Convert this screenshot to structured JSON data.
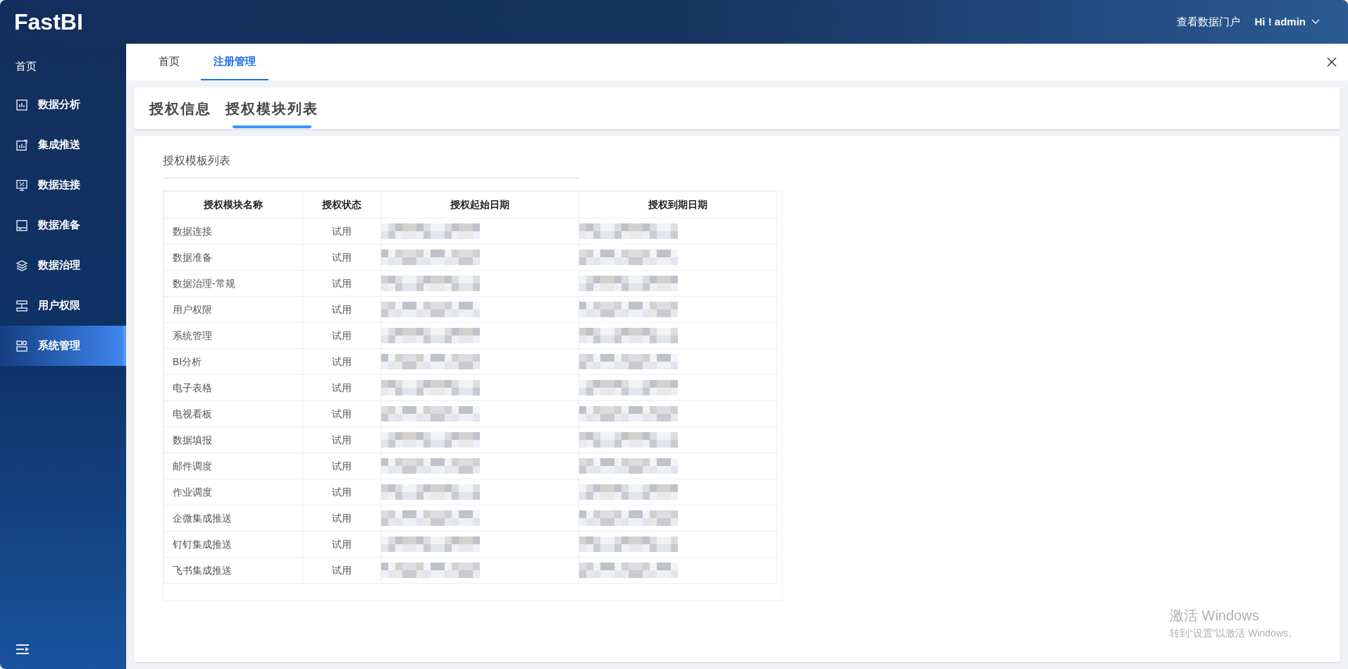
{
  "header": {
    "logo": "FastBI",
    "portal_link": "查看数据门户",
    "user_menu": "Hi ! admin"
  },
  "sidebar": {
    "home": "首页",
    "items": [
      {
        "label": "数据分析",
        "selected": false
      },
      {
        "label": "集成推送",
        "selected": false
      },
      {
        "label": "数据连接",
        "selected": false
      },
      {
        "label": "数据准备",
        "selected": false
      },
      {
        "label": "数据治理",
        "selected": false
      },
      {
        "label": "用户权限",
        "selected": false
      },
      {
        "label": "系统管理",
        "selected": true
      }
    ]
  },
  "tabs": [
    {
      "label": "首页",
      "selected": false
    },
    {
      "label": "注册管理",
      "selected": true
    }
  ],
  "sub_tabs": [
    {
      "label": "授权信息",
      "selected": false
    },
    {
      "label": "授权模块列表",
      "selected": true
    }
  ],
  "section_title": "授权模板列表",
  "table": {
    "columns": [
      "授权模块名称",
      "授权状态",
      "授权起始日期",
      "授权到期日期"
    ],
    "rows": [
      {
        "name": "数据连接",
        "status": "试用"
      },
      {
        "name": "数据准备",
        "status": "试用"
      },
      {
        "name": "数据治理-常规",
        "status": "试用"
      },
      {
        "name": "用户权限",
        "status": "试用"
      },
      {
        "name": "系统管理",
        "status": "试用"
      },
      {
        "name": "BI分析",
        "status": "试用"
      },
      {
        "name": "电子表格",
        "status": "试用"
      },
      {
        "name": "电视看板",
        "status": "试用"
      },
      {
        "name": "数据填报",
        "status": "试用"
      },
      {
        "name": "邮件调度",
        "status": "试用"
      },
      {
        "name": "作业调度",
        "status": "试用"
      },
      {
        "name": "企微集成推送",
        "status": "试用"
      },
      {
        "name": "钉钉集成推送",
        "status": "试用"
      },
      {
        "name": "飞书集成推送",
        "status": "试用"
      }
    ]
  },
  "os_overlay": {
    "title": "激活 Windows",
    "hint": "转到“设置”以激活 Windows。"
  }
}
